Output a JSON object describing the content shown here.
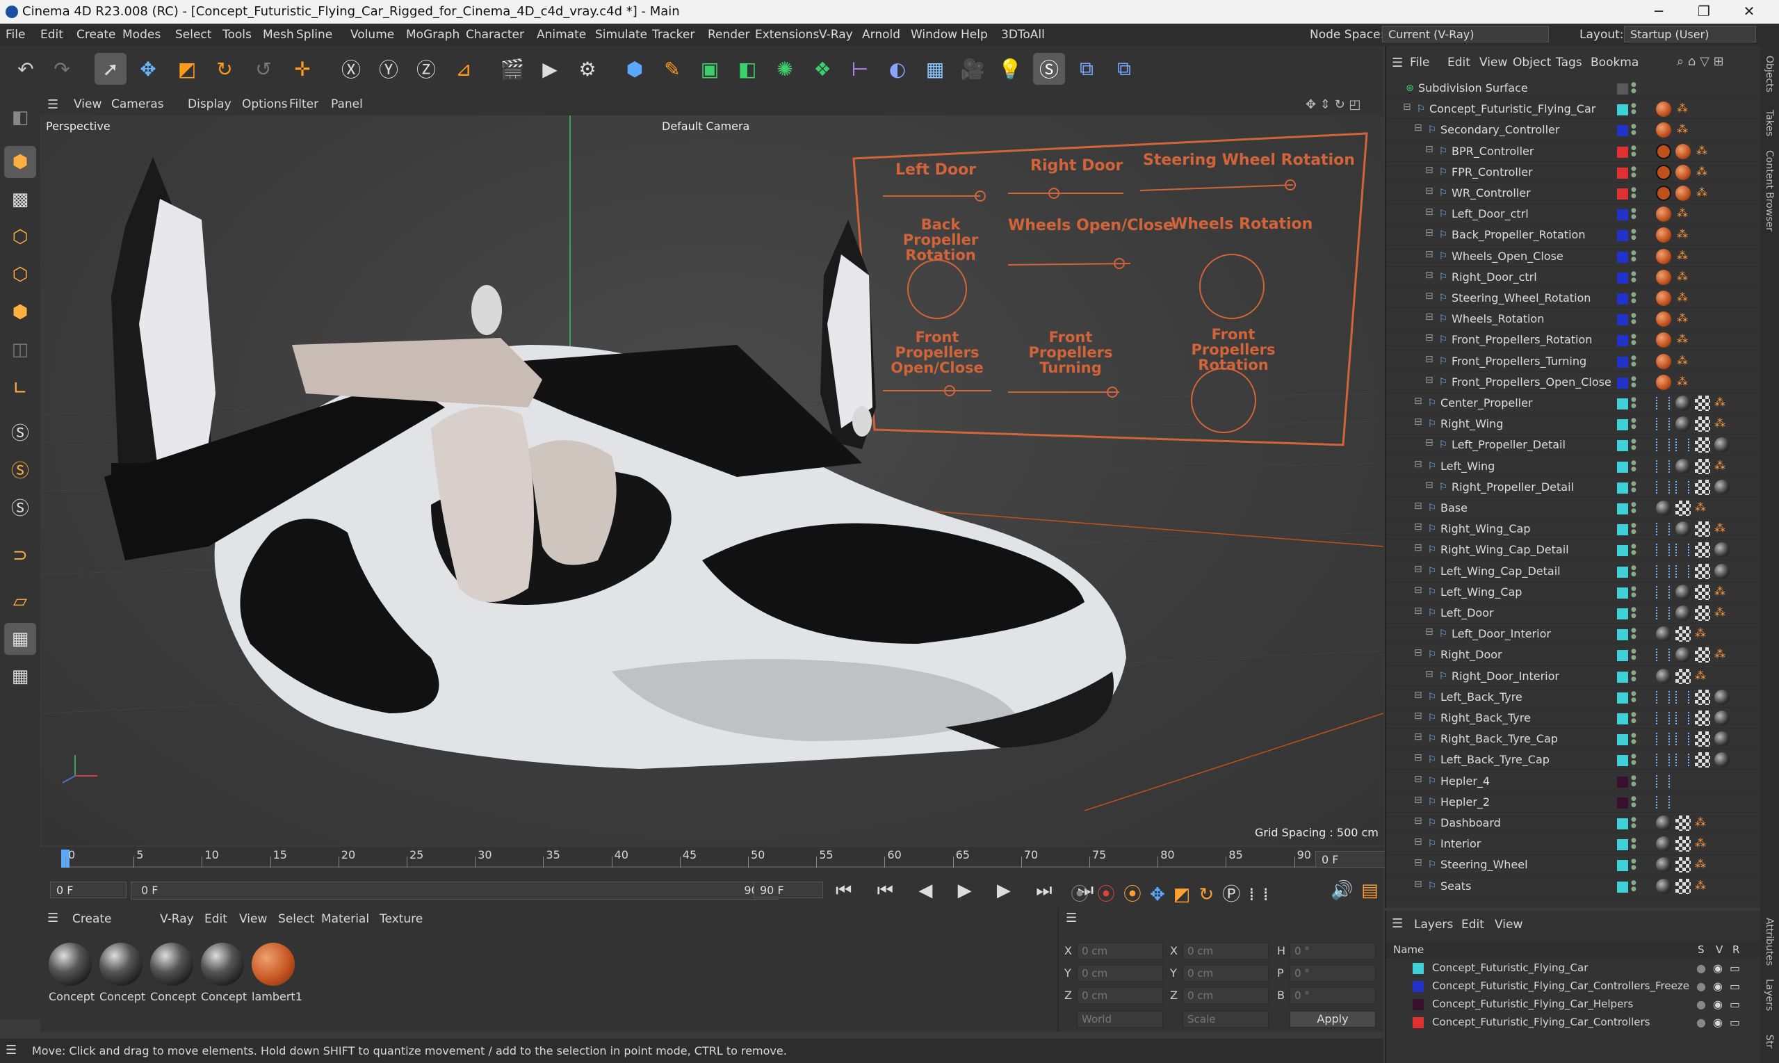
{
  "titlebar": {
    "title": "Cinema 4D R23.008 (RC) - [Concept_Futuristic_Flying_Car_Rigged_for_Cinema_4D_c4d_vray.c4d *] - Main"
  },
  "menubar": {
    "items": [
      "File",
      "Edit",
      "Create",
      "Modes",
      "Select",
      "Tools",
      "Mesh",
      "Spline",
      "Volume",
      "MoGraph",
      "Character",
      "Animate",
      "Simulate",
      "Tracker",
      "Render",
      "Extensions",
      "V-Ray",
      "Arnold",
      "Window",
      "Help",
      "3DToAll"
    ],
    "node_space_label": "Node Space:",
    "node_space_value": "Current (V-Ray)",
    "layout_label": "Layout:",
    "layout_value": "Startup (User)"
  },
  "viewport": {
    "menu": [
      "View",
      "Cameras",
      "Display",
      "Options",
      "Filter",
      "Panel"
    ],
    "label": "Perspective",
    "camera": "Default Camera",
    "grid_spacing": "Grid Spacing : 500 cm"
  },
  "rig": {
    "left_door": "Left Door",
    "right_door": "Right Door",
    "steering": "Steering Wheel Rotation",
    "back_prop_1": "Back Propeller",
    "back_prop_2": "Rotation",
    "wheels_oc": "Wheels Open/Close",
    "wheels_rot": "Wheels Rotation",
    "fp_oc_1": "Front Propellers",
    "fp_oc_2": "Open/Close",
    "fp_turn_1": "Front Propellers",
    "fp_turn_2": "Turning",
    "fp_rot_1": "Front Propellers",
    "fp_rot_2": "Rotation"
  },
  "timeline": {
    "ticks": [
      "0",
      "5",
      "10",
      "15",
      "20",
      "25",
      "30",
      "35",
      "40",
      "45",
      "50",
      "55",
      "60",
      "65",
      "70",
      "75",
      "80",
      "85",
      "90"
    ],
    "current_frame": "0 F"
  },
  "transport": {
    "start": "0 F",
    "range_start": "0 F",
    "range_end": "90 F",
    "end": "90 F"
  },
  "materials": {
    "menu": [
      "Create",
      "V-Ray",
      "Edit",
      "View",
      "Select",
      "Material",
      "Texture"
    ],
    "items": [
      {
        "label": "Concept",
        "kind": "dark"
      },
      {
        "label": "Concept",
        "kind": "dark"
      },
      {
        "label": "Concept",
        "kind": "dark"
      },
      {
        "label": "Concept",
        "kind": "dark"
      },
      {
        "label": "lambert1",
        "kind": "orange"
      }
    ]
  },
  "coords": {
    "x": "0 cm",
    "y": "0 cm",
    "z": "0 cm",
    "x2": "0 cm",
    "y2": "0 cm",
    "z2": "0 cm",
    "h": "0 °",
    "p": "0 °",
    "b": "0 °",
    "world": "World",
    "scale": "Scale",
    "apply": "Apply",
    "lbl_x": "X",
    "lbl_y": "Y",
    "lbl_z": "Z",
    "lbl_h": "H",
    "lbl_p": "P",
    "lbl_b": "B"
  },
  "status": {
    "text": "Move: Click and drag to move elements. Hold down SHIFT to quantize movement / add to the selection in point mode, CTRL to remove."
  },
  "objects": {
    "menu": [
      "File",
      "Edit",
      "View",
      "Object",
      "Tags",
      "Bookma"
    ],
    "rows": [
      {
        "name": "Subdivision Surface",
        "indent": 0,
        "color": "#5a5a5a",
        "tags": ""
      },
      {
        "name": "Concept_Futuristic_Flying_Car",
        "indent": 1,
        "color": "#3fd0d8",
        "tags": "ball"
      },
      {
        "name": "Secondary_Controller",
        "indent": 2,
        "color": "#2233cc",
        "tags": "ball"
      },
      {
        "name": "BPR_Controller",
        "indent": 3,
        "color": "#e03030",
        "tags": "no"
      },
      {
        "name": "FPR_Controller",
        "indent": 3,
        "color": "#e03030",
        "tags": "no"
      },
      {
        "name": "WR_Controller",
        "indent": 3,
        "color": "#e03030",
        "tags": "no"
      },
      {
        "name": "Left_Door_ctrl",
        "indent": 3,
        "color": "#2233cc",
        "tags": "ball"
      },
      {
        "name": "Back_Propeller_Rotation",
        "indent": 3,
        "color": "#2233cc",
        "tags": "ball"
      },
      {
        "name": "Wheels_Open_Close",
        "indent": 3,
        "color": "#2233cc",
        "tags": "ball"
      },
      {
        "name": "Right_Door_ctrl",
        "indent": 3,
        "color": "#2233cc",
        "tags": "ball"
      },
      {
        "name": "Steering_Wheel_Rotation",
        "indent": 3,
        "color": "#2233cc",
        "tags": "ball"
      },
      {
        "name": "Wheels_Rotation",
        "indent": 3,
        "color": "#2233cc",
        "tags": "ball"
      },
      {
        "name": "Front_Propellers_Rotation",
        "indent": 3,
        "color": "#2233cc",
        "tags": "ball"
      },
      {
        "name": "Front_Propellers_Turning",
        "indent": 3,
        "color": "#2233cc",
        "tags": "ball"
      },
      {
        "name": "Front_Propellers_Open_Close",
        "indent": 3,
        "color": "#2233cc",
        "tags": "ball"
      },
      {
        "name": "Center_Propeller",
        "indent": 2,
        "color": "#3fd0d8",
        "tags": "mix"
      },
      {
        "name": "Right_Wing",
        "indent": 2,
        "color": "#3fd0d8",
        "tags": "mix"
      },
      {
        "name": "Left_Propeller_Detail",
        "indent": 3,
        "color": "#3fd0d8",
        "tags": "mix2"
      },
      {
        "name": "Left_Wing",
        "indent": 2,
        "color": "#3fd0d8",
        "tags": "mix"
      },
      {
        "name": "Right_Propeller_Detail",
        "indent": 3,
        "color": "#3fd0d8",
        "tags": "mix2"
      },
      {
        "name": "Base",
        "indent": 2,
        "color": "#3fd0d8",
        "tags": "mix3"
      },
      {
        "name": "Right_Wing_Cap",
        "indent": 2,
        "color": "#3fd0d8",
        "tags": "mix"
      },
      {
        "name": "Right_Wing_Cap_Detail",
        "indent": 2,
        "color": "#3fd0d8",
        "tags": "mix2"
      },
      {
        "name": "Left_Wing_Cap_Detail",
        "indent": 2,
        "color": "#3fd0d8",
        "tags": "mix2"
      },
      {
        "name": "Left_Wing_Cap",
        "indent": 2,
        "color": "#3fd0d8",
        "tags": "mix"
      },
      {
        "name": "Left_Door",
        "indent": 2,
        "color": "#3fd0d8",
        "tags": "mix"
      },
      {
        "name": "Left_Door_Interior",
        "indent": 3,
        "color": "#3fd0d8",
        "tags": "mix3"
      },
      {
        "name": "Right_Door",
        "indent": 2,
        "color": "#3fd0d8",
        "tags": "mix"
      },
      {
        "name": "Right_Door_Interior",
        "indent": 3,
        "color": "#3fd0d8",
        "tags": "mix3"
      },
      {
        "name": "Left_Back_Tyre",
        "indent": 2,
        "color": "#3fd0d8",
        "tags": "mix2"
      },
      {
        "name": "Right_Back_Tyre",
        "indent": 2,
        "color": "#3fd0d8",
        "tags": "mix2"
      },
      {
        "name": "Right_Back_Tyre_Cap",
        "indent": 2,
        "color": "#3fd0d8",
        "tags": "mix2"
      },
      {
        "name": "Left_Back_Tyre_Cap",
        "indent": 2,
        "color": "#3fd0d8",
        "tags": "mix2"
      },
      {
        "name": "Hepler_4",
        "indent": 2,
        "color": "#3a1030",
        "tags": "dots"
      },
      {
        "name": "Hepler_2",
        "indent": 2,
        "color": "#3a1030",
        "tags": "dots"
      },
      {
        "name": "Dashboard",
        "indent": 2,
        "color": "#3fd0d8",
        "tags": "mix3"
      },
      {
        "name": "Interior",
        "indent": 2,
        "color": "#3fd0d8",
        "tags": "mix3"
      },
      {
        "name": "Steering_Wheel",
        "indent": 2,
        "color": "#3fd0d8",
        "tags": "mix3"
      },
      {
        "name": "Seats",
        "indent": 2,
        "color": "#3fd0d8",
        "tags": "mix3"
      }
    ]
  },
  "layers": {
    "menu": [
      "Layers",
      "Edit",
      "View"
    ],
    "header": {
      "name": "Name",
      "s": "S",
      "v": "V",
      "r": "R"
    },
    "rows": [
      {
        "name": "Concept_Futuristic_Flying_Car",
        "color": "#3fd0d8"
      },
      {
        "name": "Concept_Futuristic_Flying_Car_Controllers_Freeze",
        "color": "#2233cc"
      },
      {
        "name": "Concept_Futuristic_Flying_Car_Helpers",
        "color": "#3a1030"
      },
      {
        "name": "Concept_Futuristic_Flying_Car_Controllers",
        "color": "#e03030"
      }
    ]
  },
  "right_tabs": [
    "Objects",
    "Takes",
    "Content Browser",
    "Attributes",
    "Layers",
    "Str"
  ]
}
